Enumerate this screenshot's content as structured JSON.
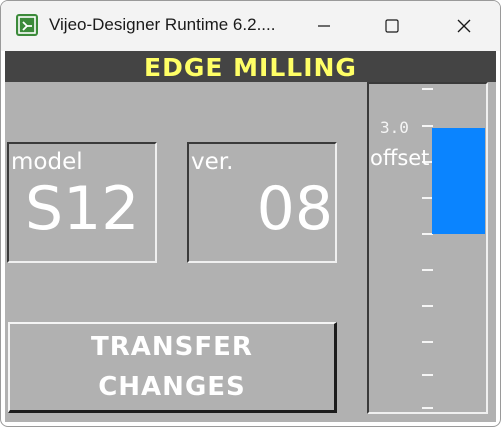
{
  "window": {
    "title": "Vijeo-Designer Runtime 6.2...."
  },
  "hmi": {
    "header_title": "EDGE MILLING",
    "model": {
      "label": "model",
      "value": "S12"
    },
    "version": {
      "label": "ver.",
      "value": "08"
    },
    "gauge": {
      "label": "offset",
      "max_label": "3.0",
      "bar_color": "#0a84ff"
    },
    "transfer_button": {
      "line1": "TRANSFER",
      "line2": "CHANGES"
    }
  },
  "colors": {
    "background": "#b1b1b1",
    "header_bg": "#444444",
    "header_text": "#ffff66",
    "value_text": "#ffffff"
  }
}
